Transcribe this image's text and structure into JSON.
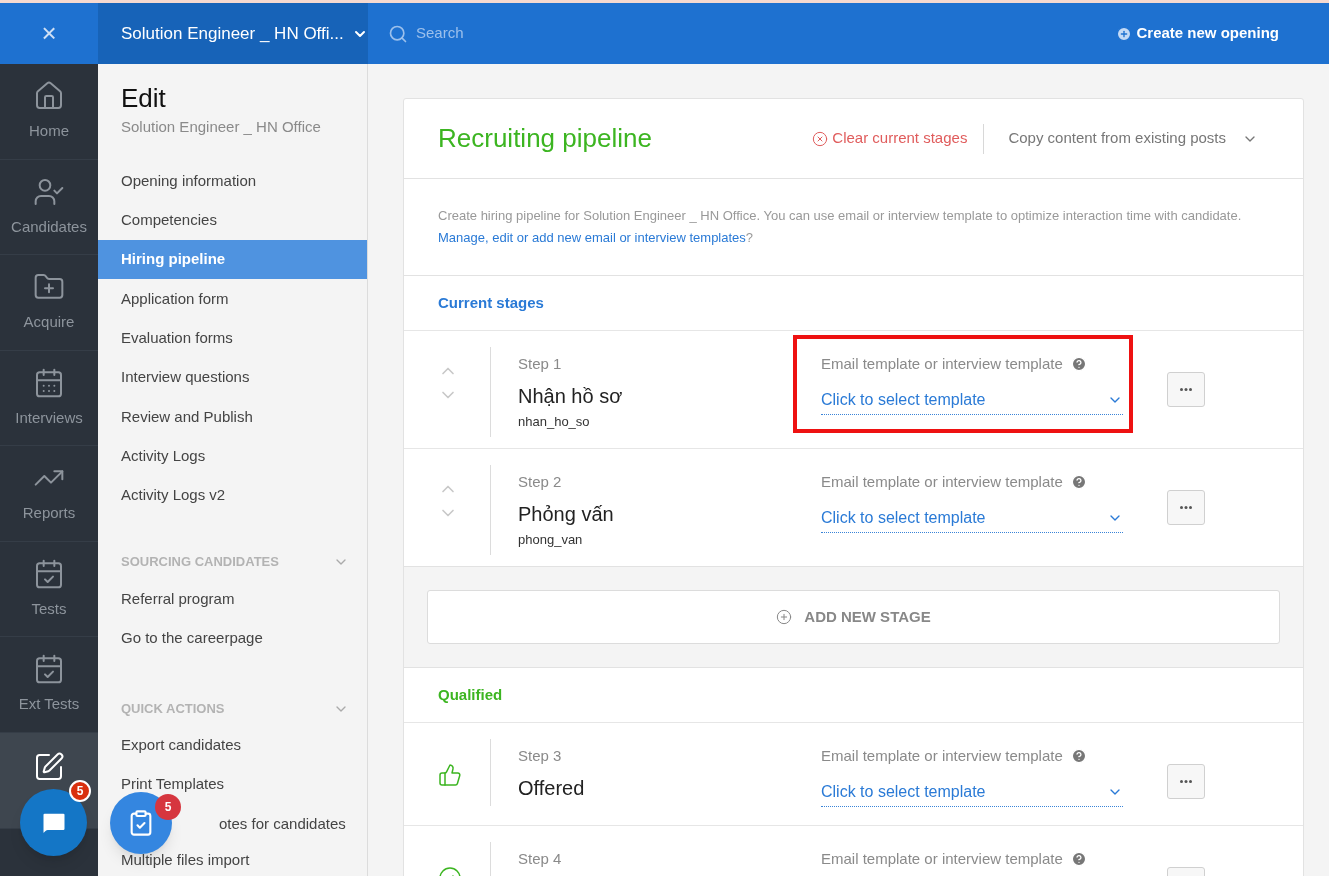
{
  "topbar": {
    "close": "×",
    "opening_title": "Solution Engineer _ HN Offi...",
    "search": {
      "placeholder": "Search"
    },
    "create_button": "Create new opening"
  },
  "rail": [
    {
      "label": "Home",
      "selected": false
    },
    {
      "label": "Candidates",
      "selected": false
    },
    {
      "label": "Acquire",
      "selected": false
    },
    {
      "label": "Interviews",
      "selected": false
    },
    {
      "label": "Reports",
      "selected": false
    },
    {
      "label": "Tests",
      "selected": false
    },
    {
      "label": "Ext Tests",
      "selected": false
    },
    {
      "selected": true
    }
  ],
  "sidebar": {
    "title": "Edit",
    "subtitle": "Solution Engineer _ HN Office",
    "items": [
      {
        "label": "Opening information",
        "selected": false
      },
      {
        "label": "Competencies",
        "selected": false
      },
      {
        "label": "Hiring pipeline",
        "selected": true
      },
      {
        "label": "Application form",
        "selected": false
      },
      {
        "label": "Evaluation forms",
        "selected": false
      },
      {
        "label": "Interview questions",
        "selected": false
      },
      {
        "label": "Review and Publish",
        "selected": false
      },
      {
        "label": "Activity Logs",
        "selected": false
      },
      {
        "label": "Activity Logs v2",
        "selected": false
      }
    ],
    "sections": [
      {
        "title": "SOURCING CANDIDATES",
        "items": [
          "Referral program",
          "Go to the careerpage"
        ]
      },
      {
        "title": "QUICK ACTIONS",
        "items": [
          "Export candidates",
          "Print Templates",
          "otes for candidates",
          "Multiple files import"
        ]
      }
    ]
  },
  "fabs": [
    {
      "badge": "5"
    },
    {
      "badge": "5"
    }
  ],
  "card": {
    "title": "Recruiting pipeline",
    "clear_button": "Clear current stages",
    "copy_dropdown": "Copy content from existing posts",
    "description": "Create hiring pipeline for Solution Engineer _ HN Office. You can use email or interview template to optimize interaction time with candidate. ",
    "link": "Manage, edit or add new email or interview templates",
    "after_link": "?",
    "groups": [
      {
        "title": "Current stages",
        "kind": "current",
        "stages": [
          {
            "step": "Step 1",
            "name": "Nhận hồ sơ",
            "code": "nhan_ho_so",
            "kind": "reorderable",
            "template_label": "Email template or interview template",
            "template_value": "Click to select template",
            "highlighted": true
          },
          {
            "step": "Step 2",
            "name": "Phỏng vấn",
            "code": "phong_van",
            "kind": "reorderable",
            "template_label": "Email template or interview template",
            "template_value": "Click to select template",
            "highlighted": false
          }
        ],
        "add_button": "ADD NEW STAGE"
      },
      {
        "title": "Qualified",
        "kind": "qualified",
        "stages": [
          {
            "step": "Step 3",
            "name": "Offered",
            "kind": "offered",
            "template_label": "Email template or interview template",
            "template_value": "Click to select template",
            "highlighted": false
          },
          {
            "step": "Step 4",
            "kind": "done",
            "template_label": "Email template or interview template",
            "highlighted": false
          }
        ]
      }
    ]
  }
}
